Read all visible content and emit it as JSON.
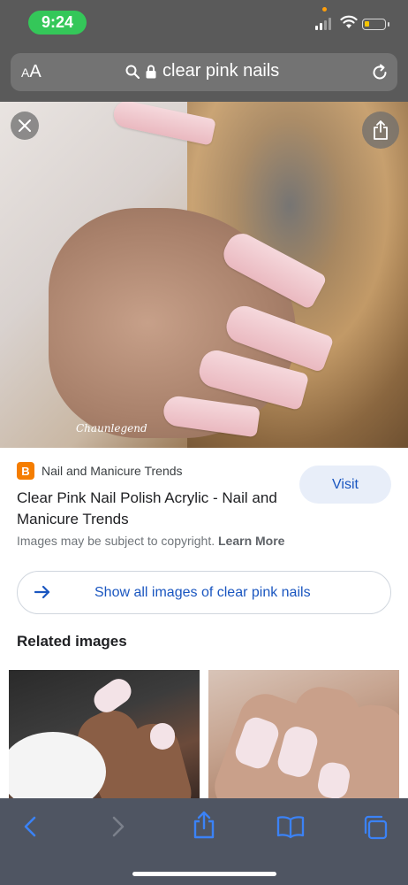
{
  "status_bar": {
    "time": "9:24"
  },
  "url_bar": {
    "text_size_label_small": "A",
    "text_size_label_large": "A",
    "query": "clear pink nails"
  },
  "hero": {
    "watermark": "Chaunlegend"
  },
  "result": {
    "source_name": "Nail and Manicure Trends",
    "source_icon_letter": "B",
    "title": "Clear Pink Nail Polish Acrylic - Nail and Manicure Trends",
    "visit_label": "Visit",
    "copyright_text": "Images may be subject to copyright.",
    "learn_more_label": "Learn More"
  },
  "show_all": {
    "label": "Show all images of clear pink nails"
  },
  "related": {
    "heading": "Related images"
  },
  "colors": {
    "accent_blue": "#1a56c0",
    "status_green": "#34c759",
    "blogger_orange": "#f57d00",
    "toolbar_bg": "#4f5562"
  },
  "icons": [
    "search-icon",
    "lock-icon",
    "reload-icon",
    "close-icon",
    "share-icon",
    "arrow-right-icon",
    "back-icon",
    "forward-icon",
    "bookmarks-icon",
    "tabs-icon"
  ]
}
